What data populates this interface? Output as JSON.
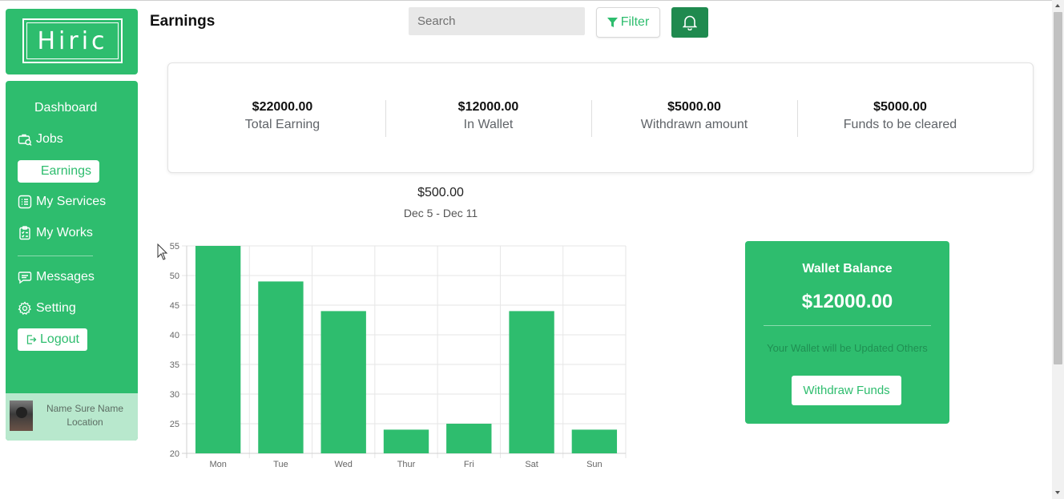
{
  "brand": {
    "logo_text": "Hiric"
  },
  "sidebar": {
    "items": [
      {
        "label": "Dashboard",
        "icon": "none"
      },
      {
        "label": "Jobs",
        "icon": "jobs-icon"
      },
      {
        "label": "Earnings",
        "icon": "earnings-icon",
        "active": true
      },
      {
        "label": "My Services",
        "icon": "list-icon"
      },
      {
        "label": "My Works",
        "icon": "clipboard-icon"
      },
      {
        "label": "Messages",
        "icon": "message-icon"
      },
      {
        "label": "Setting",
        "icon": "gear-icon"
      }
    ],
    "logout_label": "Logout",
    "profile": {
      "name": "Name Sure Name",
      "location": "Location"
    }
  },
  "header": {
    "title": "Earnings",
    "search_placeholder": "Search",
    "filter_label": "Filter"
  },
  "stats": [
    {
      "value": "$22000.00",
      "label": "Total Earning"
    },
    {
      "value": "$12000.00",
      "label": "In Wallet"
    },
    {
      "value": "$5000.00",
      "label": "Withdrawn amount"
    },
    {
      "value": "$5000.00",
      "label": "Funds to be cleared"
    }
  ],
  "chart_header": {
    "amount": "$500.00",
    "range": "Dec 5 - Dec 11"
  },
  "chart_data": {
    "type": "bar",
    "categories": [
      "Mon",
      "Tue",
      "Wed",
      "Thur",
      "Fri",
      "Sat",
      "Sun"
    ],
    "values": [
      55,
      49,
      44,
      24,
      25,
      44,
      24
    ],
    "ylim": [
      20,
      55
    ],
    "yticks": [
      20,
      25,
      30,
      35,
      40,
      45,
      50,
      55
    ],
    "xlabel": "",
    "ylabel": "",
    "title": "",
    "grid": true,
    "color": "#2ebd6e"
  },
  "wallet": {
    "title": "Wallet Balance",
    "amount": "$12000.00",
    "note": "Your Wallet will be Updated Others",
    "button_label": "Withdraw Funds"
  },
  "colors": {
    "accent": "#2ebd6e",
    "accent_dark": "#1f8a4f"
  }
}
